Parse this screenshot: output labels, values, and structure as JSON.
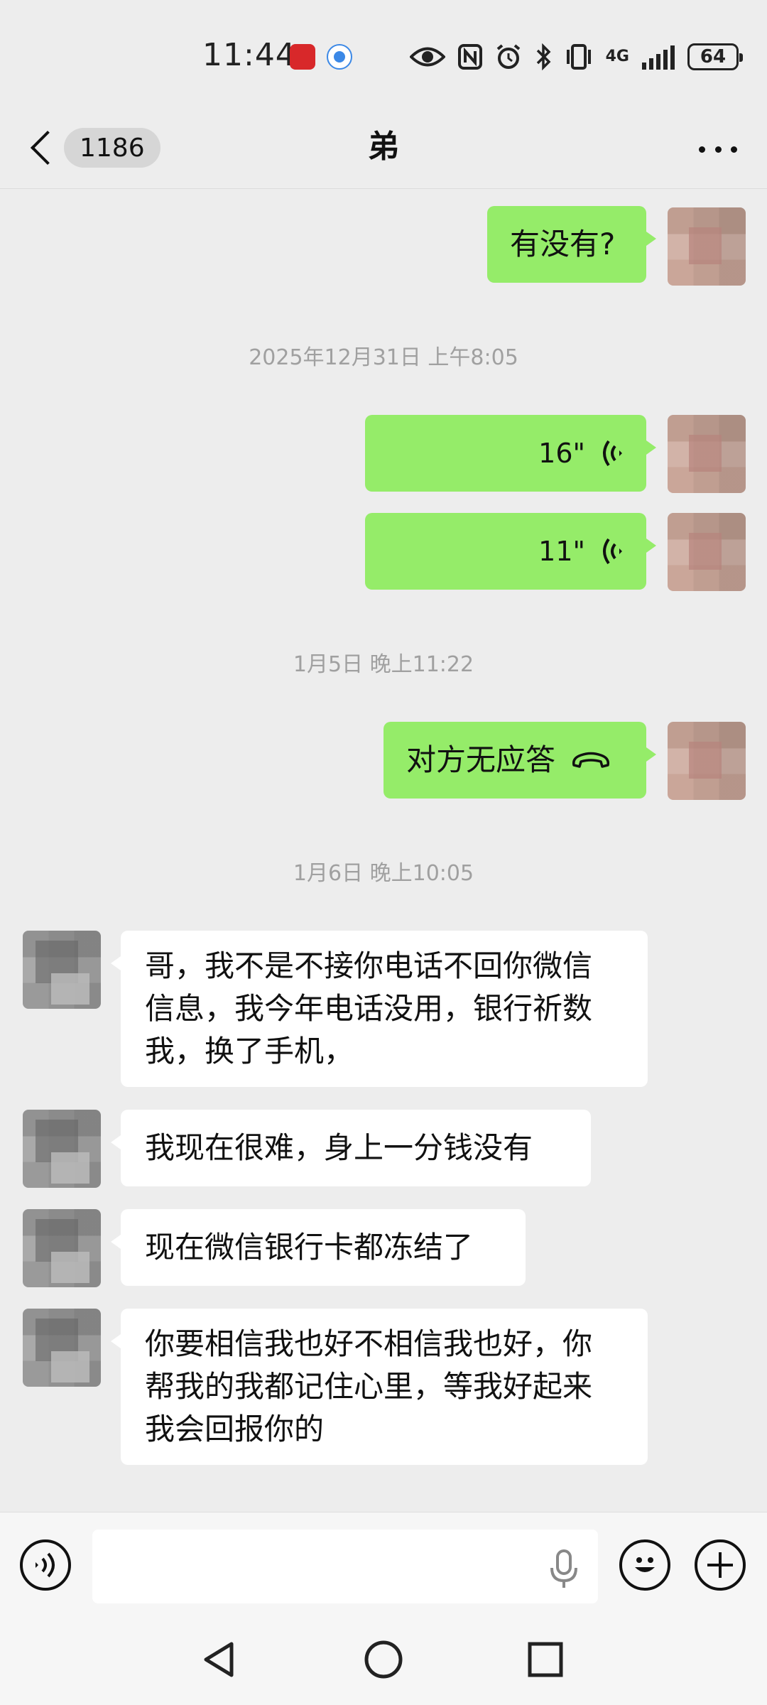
{
  "status_bar": {
    "time": "11:44",
    "network": "4G",
    "battery": "64",
    "icons": [
      "app-notification-icon",
      "browser-notification-icon",
      "eye-icon",
      "nfc-icon",
      "alarm-icon",
      "bluetooth-icon",
      "vibrate-icon",
      "signal-icon",
      "battery-icon"
    ]
  },
  "header": {
    "unread_count": "1186",
    "title": "弟"
  },
  "messages": [
    {
      "type": "text",
      "from": "me",
      "text": "有没有?"
    },
    {
      "type": "timestamp",
      "text": "2025年12月31日 上午8:05"
    },
    {
      "type": "voice",
      "from": "me",
      "duration": "16\""
    },
    {
      "type": "voice",
      "from": "me",
      "duration": "11\""
    },
    {
      "type": "timestamp",
      "text": "1月5日 晚上11:22"
    },
    {
      "type": "call",
      "from": "me",
      "text": "对方无应答"
    },
    {
      "type": "timestamp",
      "text": "1月6日 晚上10:05"
    },
    {
      "type": "text",
      "from": "other",
      "lines": [
        "哥，我不是不接你电话不回你微信",
        "信息，我今年电话没用，银行祈数",
        "我，换了手机，"
      ]
    },
    {
      "type": "text",
      "from": "other",
      "text": "我现在很难，身上一分钱没有"
    },
    {
      "type": "text",
      "from": "other",
      "text": "现在微信银行卡都冻结了"
    },
    {
      "type": "text",
      "from": "other",
      "lines": [
        "你要相信我也好不相信我也好，你",
        "帮我的我都记住心里，等我好起来",
        "我会回报你的"
      ]
    }
  ],
  "input_bar": {
    "placeholder": "",
    "icons": [
      "voice-mode-icon",
      "microphone-icon",
      "emoji-icon",
      "add-icon"
    ]
  },
  "nav_bar": {
    "icons": [
      "back-nav-icon",
      "home-nav-icon",
      "recents-nav-icon"
    ]
  },
  "colors": {
    "background": "#ededed",
    "my_bubble": "#95ec69",
    "other_bubble": "#ffffff",
    "timestamp": "#a0a0a0"
  }
}
